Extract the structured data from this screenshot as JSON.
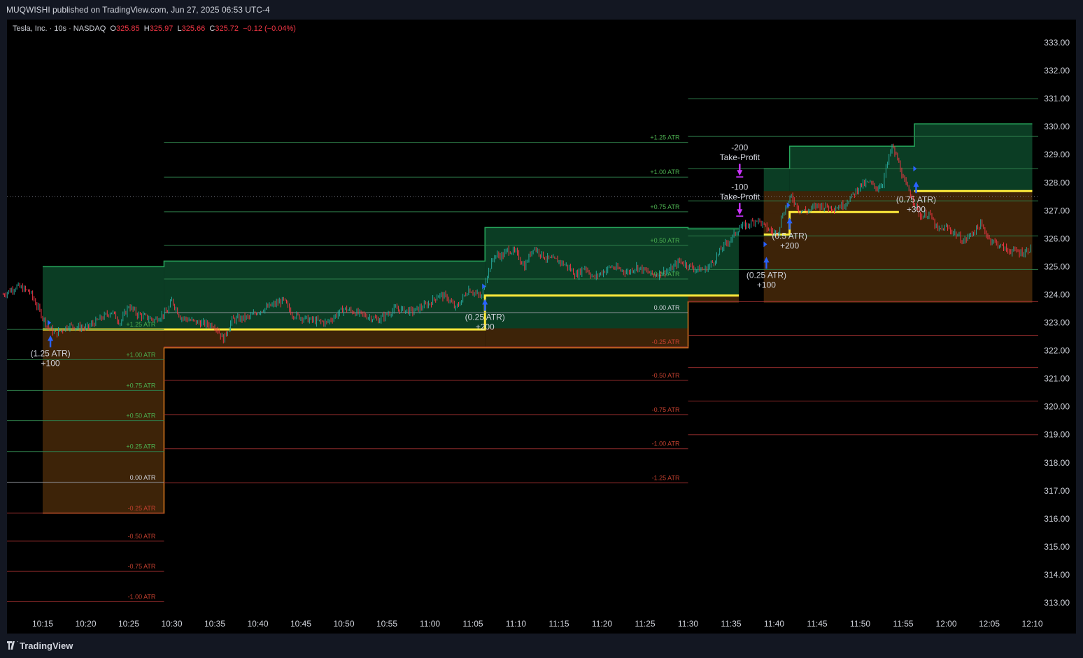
{
  "header": {
    "published": "MUQWISHI published on TradingView.com, Jun 27, 2025 06:53 UTC-4"
  },
  "legend": {
    "symbol": "Tesla, Inc. · 10s · NASDAQ",
    "o_label": "O",
    "o": "325.85",
    "h_label": "H",
    "h": "325.97",
    "l_label": "L",
    "l": "325.66",
    "c_label": "C",
    "c": "325.72",
    "change": "−0.12 (−0.04%)"
  },
  "footer": {
    "brand": "TradingView"
  },
  "colors": {
    "bull": "#26a69a",
    "bear": "#f23645",
    "entry": "#ffeb3b",
    "profit_fill": "#0b3d24",
    "loss_fill": "#3d2308",
    "arrow_up": "#2962ff",
    "take_profit": "#cc33ff"
  },
  "chart_data": {
    "type": "candlestick",
    "title": "Tesla, Inc. · 10s · NASDAQ",
    "ylim": [
      312.5,
      333.5
    ],
    "y_ticks": [
      "333.00",
      "332.00",
      "331.00",
      "330.00",
      "329.00",
      "328.00",
      "327.00",
      "326.00",
      "325.00",
      "324.00",
      "323.00",
      "322.00",
      "321.00",
      "320.00",
      "319.00",
      "318.00",
      "317.00",
      "316.00",
      "315.00",
      "314.00",
      "313.00"
    ],
    "x_ticks": [
      "10:15",
      "10:20",
      "10:25",
      "10:30",
      "10:35",
      "10:40",
      "10:45",
      "10:50",
      "10:55",
      "11:00",
      "11:05",
      "11:10",
      "11:15",
      "11:20",
      "11:25",
      "11:30",
      "11:35",
      "11:40",
      "11:45",
      "11:50",
      "11:55",
      "12:00",
      "12:05",
      "12:10"
    ],
    "x_tick_minutes": [
      615,
      620,
      625,
      630,
      635,
      640,
      645,
      650,
      655,
      660,
      665,
      670,
      675,
      680,
      685,
      690,
      695,
      700,
      705,
      710,
      715,
      720,
      725,
      730
    ],
    "price_path": [
      [
        610.4,
        324.0
      ],
      [
        612,
        324.3
      ],
      [
        613.5,
        324.1
      ],
      [
        615.5,
        322.9
      ],
      [
        616.5,
        322.6
      ],
      [
        618,
        322.9
      ],
      [
        620,
        322.8
      ],
      [
        622,
        323.2
      ],
      [
        623,
        323.4
      ],
      [
        624,
        323.0
      ],
      [
        625,
        323.6
      ],
      [
        626,
        323.3
      ],
      [
        628,
        323.1
      ],
      [
        629.5,
        323.4
      ],
      [
        630,
        323.8
      ],
      [
        631,
        323.2
      ],
      [
        633,
        323.0
      ],
      [
        635,
        322.9
      ],
      [
        636,
        322.4
      ],
      [
        637,
        323.1
      ],
      [
        639,
        323.2
      ],
      [
        640,
        323.4
      ],
      [
        643,
        323.8
      ],
      [
        644,
        323.3
      ],
      [
        646,
        323.1
      ],
      [
        648,
        323.0
      ],
      [
        650,
        323.5
      ],
      [
        652,
        323.3
      ],
      [
        654,
        323.1
      ],
      [
        656,
        323.5
      ],
      [
        658,
        323.4
      ],
      [
        660,
        323.7
      ],
      [
        661,
        324.0
      ],
      [
        662,
        323.9
      ],
      [
        663,
        323.5
      ],
      [
        664.5,
        324.2
      ],
      [
        666,
        323.9
      ],
      [
        666.5,
        324.6
      ],
      [
        667.5,
        325.4
      ],
      [
        668.5,
        325.4
      ],
      [
        669,
        325.6
      ],
      [
        670,
        325.5
      ],
      [
        671,
        325.0
      ],
      [
        672,
        325.7
      ],
      [
        673.5,
        325.3
      ],
      [
        675,
        325.2
      ],
      [
        676,
        325.0
      ],
      [
        677,
        324.7
      ],
      [
        678,
        325.0
      ],
      [
        679,
        324.6
      ],
      [
        681,
        325.0
      ],
      [
        683,
        324.8
      ],
      [
        684,
        325.0
      ],
      [
        686,
        324.7
      ],
      [
        688,
        324.9
      ],
      [
        689,
        325.2
      ],
      [
        691,
        324.9
      ],
      [
        692,
        324.9
      ],
      [
        693,
        325.2
      ],
      [
        694,
        325.7
      ],
      [
        695,
        326.0
      ],
      [
        696,
        326.4
      ],
      [
        697,
        326.5
      ],
      [
        698,
        326.7
      ],
      [
        699,
        326.4
      ],
      [
        700,
        326.2
      ],
      [
        700.5,
        326.3
      ],
      [
        701,
        326.9
      ],
      [
        702,
        327.5
      ],
      [
        703,
        327.0
      ],
      [
        704,
        327.0
      ],
      [
        705,
        327.2
      ],
      [
        707,
        327.1
      ],
      [
        708,
        327.2
      ],
      [
        709,
        327.5
      ],
      [
        710,
        327.9
      ],
      [
        711,
        328.0
      ],
      [
        712,
        327.8
      ],
      [
        712.6,
        328.0
      ],
      [
        713,
        328.5
      ],
      [
        713.7,
        329.3
      ],
      [
        714.5,
        328.7
      ],
      [
        715,
        328.1
      ],
      [
        716,
        327.5
      ],
      [
        717,
        326.8
      ],
      [
        718,
        326.9
      ],
      [
        719,
        326.3
      ],
      [
        720,
        326.4
      ],
      [
        721,
        326.2
      ],
      [
        722,
        325.9
      ],
      [
        723,
        326.2
      ],
      [
        724,
        326.5
      ],
      [
        725,
        326.0
      ],
      [
        727,
        325.6
      ],
      [
        729,
        325.5
      ],
      [
        730,
        325.7
      ]
    ],
    "atr_boxes": [
      {
        "label": "(1.25 ATR)",
        "qty": "+100",
        "t_start": 615,
        "t_switch": 629.1,
        "t_end": 666.4,
        "entry": 322.8,
        "stop_a": 316.2,
        "target_a": 325.0,
        "stop_b": 322.1,
        "target_b": 325.2,
        "levels_a": [
          {
            "label": "+1.25 ATR",
            "price": 322.76,
            "side": "profit"
          },
          {
            "label": "+1.00 ATR",
            "price": 321.68,
            "side": "profit"
          },
          {
            "label": "+0.75 ATR",
            "price": 320.58,
            "side": "profit"
          },
          {
            "label": "+0.50 ATR",
            "price": 319.5,
            "side": "profit"
          },
          {
            "label": "+0.25 ATR",
            "price": 318.4,
            "side": "profit"
          },
          {
            "label": "0.00 ATR",
            "price": 317.3,
            "side": "zero"
          },
          {
            "label": "-0.25 ATR",
            "price": 316.2,
            "side": "loss"
          },
          {
            "label": "-0.50 ATR",
            "price": 315.2,
            "side": "loss"
          },
          {
            "label": "-0.75 ATR",
            "price": 314.12,
            "side": "loss"
          },
          {
            "label": "-1.00 ATR",
            "price": 313.04,
            "side": "loss"
          }
        ]
      },
      {
        "label": "(0.25 ATR)",
        "qty": "+200",
        "t_switch": 666.4,
        "t_end": 690,
        "entry": 324.0,
        "target": 326.4
      },
      {
        "label": "(0.25 ATR)",
        "qty": "+100",
        "t_start": 690,
        "t_end": 695.9,
        "levels": [
          {
            "label": "+1.25 ATR",
            "price": 329.44,
            "side": "profit"
          },
          {
            "label": "+1.00 ATR",
            "price": 328.2,
            "side": "profit"
          },
          {
            "label": "+0.75 ATR",
            "price": 326.96,
            "side": "profit"
          },
          {
            "label": "+0.50 ATR",
            "price": 325.76,
            "side": "profit"
          },
          {
            "label": "+0.25 ATR",
            "price": 324.56,
            "side": "profit"
          },
          {
            "label": "0.00 ATR",
            "price": 323.36,
            "side": "zero"
          },
          {
            "label": "-0.25 ATR",
            "price": 322.14,
            "side": "loss"
          },
          {
            "label": "-0.50 ATR",
            "price": 320.94,
            "side": "loss"
          },
          {
            "label": "-0.75 ATR",
            "price": 319.72,
            "side": "loss"
          },
          {
            "label": "-1.00 ATR",
            "price": 318.5,
            "side": "loss"
          },
          {
            "label": "-1.25 ATR",
            "price": 317.28,
            "side": "loss"
          }
        ]
      }
    ],
    "trades": [
      {
        "kind": "buy",
        "t": 615.9,
        "price": 322.4,
        "label": "(1.25 ATR)",
        "qty": "+100"
      },
      {
        "kind": "buy",
        "t": 666.4,
        "price": 323.7,
        "label": "(0.25 ATR)",
        "qty": "+200"
      },
      {
        "kind": "buy",
        "t": 699.1,
        "price": 325.2,
        "label": "(0.25 ATR)",
        "qty": "+100"
      },
      {
        "kind": "buy",
        "t": 701.8,
        "price": 326.6,
        "label": "(0.5 ATR)",
        "qty": "+200"
      },
      {
        "kind": "buy",
        "t": 716.5,
        "price": 327.9,
        "label": "(0.75 ATR)",
        "qty": "+300"
      },
      {
        "kind": "sell",
        "t": 696,
        "price": 327.0,
        "label": "Take-Profit",
        "qty": "-100"
      },
      {
        "kind": "sell",
        "t": 696,
        "price": 328.4,
        "label": "Take-Profit",
        "qty": "-200"
      }
    ]
  }
}
